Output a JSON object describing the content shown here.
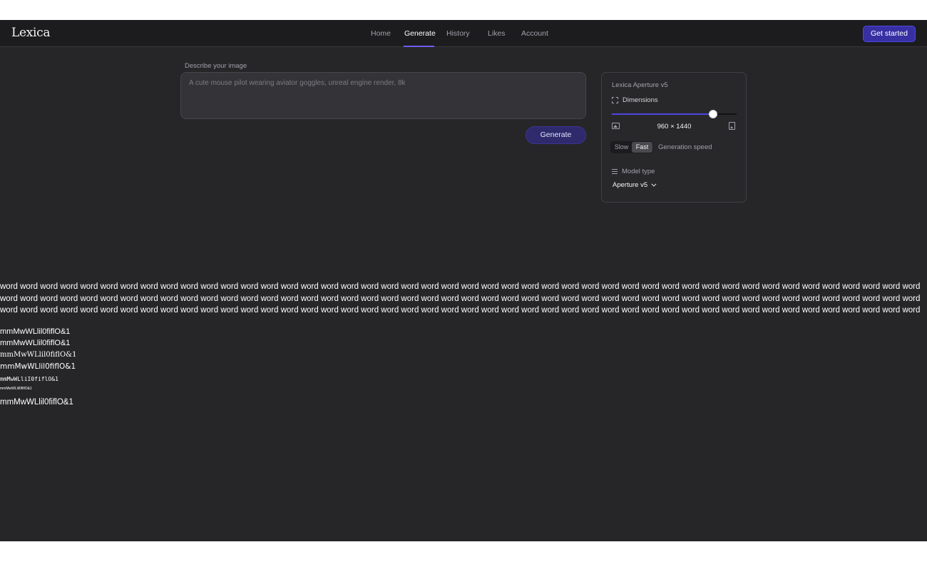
{
  "app": {
    "logo": "Lexica",
    "nav": {
      "items": [
        {
          "label": "Home",
          "active": false
        },
        {
          "label": "Generate",
          "active": true
        },
        {
          "label": "History",
          "active": false
        },
        {
          "label": "Likes",
          "active": false
        },
        {
          "label": "Account",
          "active": false
        }
      ]
    },
    "cta_label": "Get started"
  },
  "prompt": {
    "label": "Describe your image",
    "placeholder": "A cute mouse pilot wearing aviator goggles, unreal engine render, 8k",
    "value": "",
    "generate_label": "Generate"
  },
  "settings": {
    "title": "Lexica Aperture v5",
    "dimensions_label": "Dimensions",
    "dimensions_value": "960 × 1440",
    "dimension_slider_level": 0.81,
    "speed": {
      "options": [
        "Slow",
        "Fast"
      ],
      "selected": "Fast",
      "label": "Generation speed"
    },
    "model_type_label": "Model type",
    "model_selected": "Aperture v5"
  },
  "font_test": {
    "words": "word word word word word word word word word word word word word word word word word word word word word word word word word word word word word word word word word word word word word word word word word word word word word word word word word word word word word word word word word word word word word word word word word word word word word word word word word word word word word word word word word word word word word word word word word word word word word word word word word word word word word word word word word word word word word word word word word word word word word word word word word word word word word word word word word word word word word word word word word word word word word word word word word word word",
    "samples": [
      "mmMwWLlil0fiflO&1",
      "mmMwWLlil0fiflO&1",
      "mmMwWLlil0fiflO&1",
      "mmMwWLlil0fiflO&1",
      "mmMwWLliI0fiflO&1",
      "mmMwWLlil0fiflO&1",
      "mmMwWLlil0fiflO&1"
    ]
  },
  "colors": {
    "background": "#262628",
    "topbar": "#1c1c1e",
    "accent": "#4f46e5",
    "cta": "#3730a3"
  }
}
